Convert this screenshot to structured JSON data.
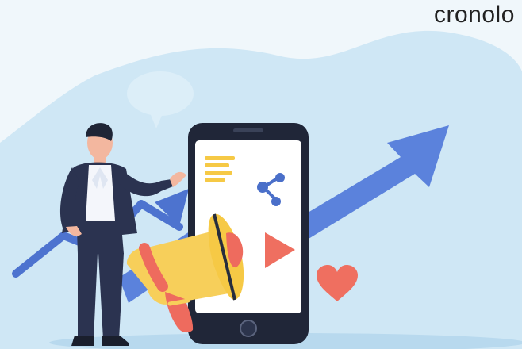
{
  "brand": {
    "text": "cronolo"
  },
  "palette": {
    "background_light": "#e6f2f8",
    "background_blob": "#cfe6f4",
    "arrow_blue": "#5279d6",
    "phone_dark": "#1f2538",
    "screen_white": "#ffffff",
    "text_lines_yellow": "#f6c945",
    "share_blue": "#4a6fc9",
    "play_coral": "#ef6f60",
    "heart_coral": "#ef6f60",
    "megaphone_yellow": "#f7cf5a",
    "megaphone_red": "#ee6b5e",
    "suit_navy": "#2b3350",
    "shirt_white": "#f4f6fb",
    "skin": "#f3b79f",
    "ground": "#bcdcee"
  },
  "icons": [
    "text-lines-icon",
    "share-icon",
    "play-icon",
    "heart-icon",
    "megaphone-icon",
    "home-button-icon"
  ]
}
